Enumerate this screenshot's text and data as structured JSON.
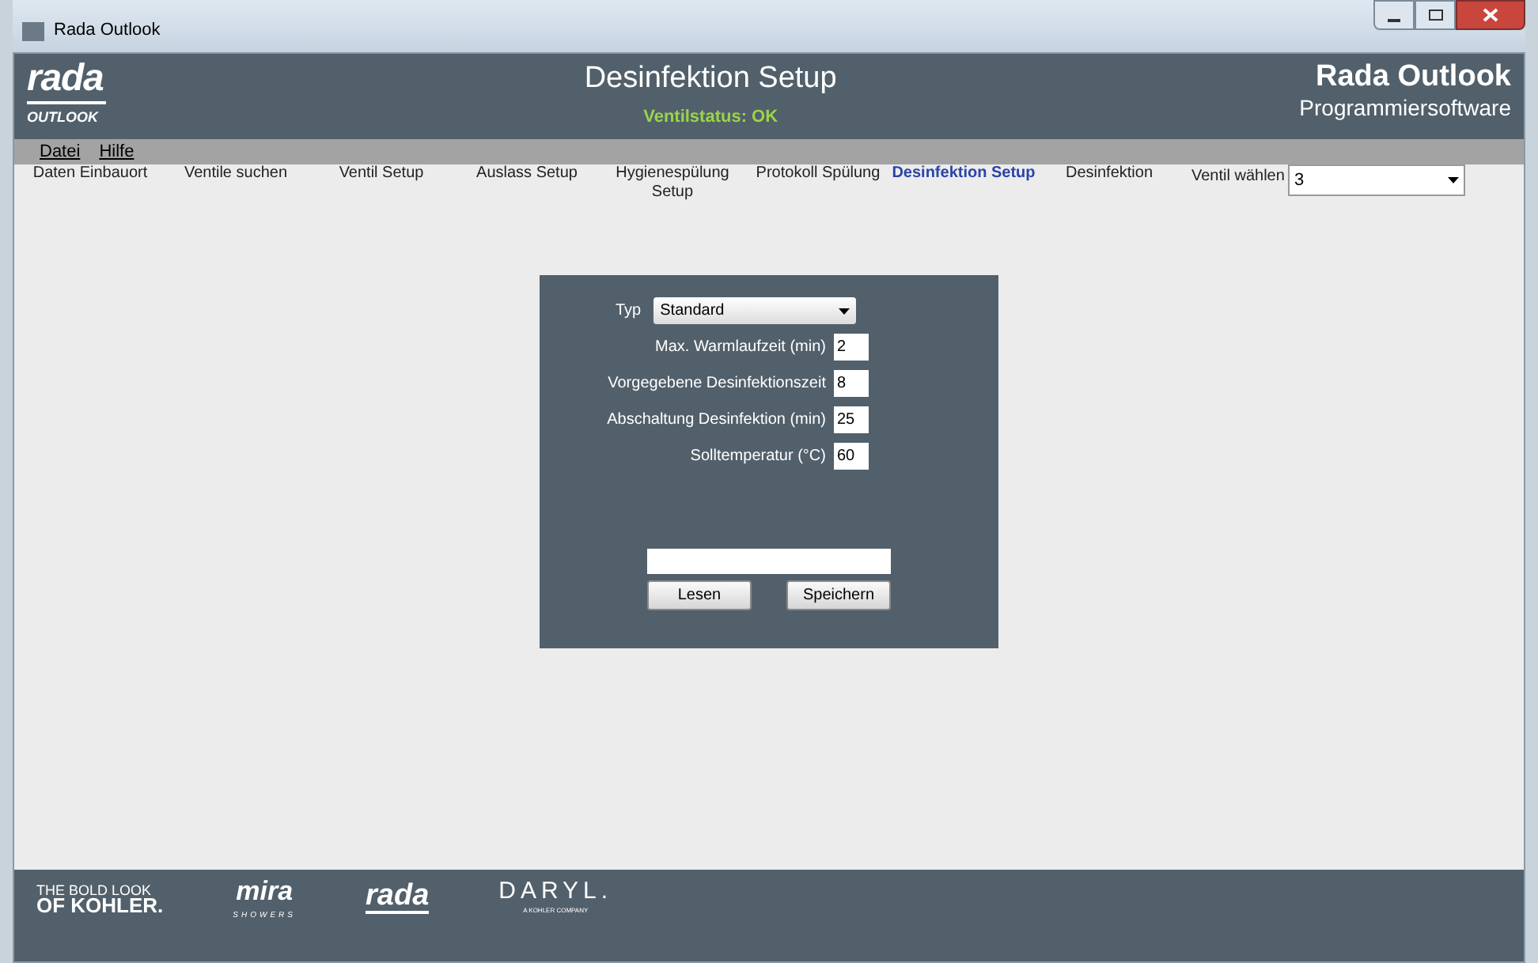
{
  "window": {
    "title": "Rada Outlook"
  },
  "header": {
    "logo_text": "rada",
    "logo_subtext": "OUTLOOK",
    "title": "Desinfektion Setup",
    "status": "Ventilstatus: OK",
    "brand": "Rada Outlook",
    "subtitle": "Programmiersoftware"
  },
  "menu": [
    "Datei",
    "Hilfe"
  ],
  "tabs": [
    {
      "label": "Daten Einbauort",
      "selected": false
    },
    {
      "label": "Ventile suchen",
      "selected": false
    },
    {
      "label": "Ventil Setup",
      "selected": false
    },
    {
      "label": "Auslass Setup",
      "selected": false
    },
    {
      "label": "Hygienespülung Setup",
      "selected": false
    },
    {
      "label": "Protokoll Spülung",
      "selected": false
    },
    {
      "label": "Desinfektion Setup",
      "selected": true
    },
    {
      "label": "Desinfektion",
      "selected": false
    }
  ],
  "valve_select": {
    "label": "Ventil wählen",
    "value": "3"
  },
  "form": {
    "type_label": "Typ",
    "type_value": "Standard",
    "fields": [
      {
        "label": "Max. Warmlaufzeit (min)",
        "value": "2"
      },
      {
        "label": "Vorgegebene Desinfektionszeit",
        "value": "8"
      },
      {
        "label": "Abschaltung Desinfektion (min)",
        "value": "25"
      },
      {
        "label": "Solltemperatur (°C)",
        "value": "60"
      }
    ],
    "buttons": [
      "Lesen",
      "Speichern"
    ]
  },
  "footer": {
    "kohler_top": "THE BOLD LOOK",
    "kohler_bottom": "OF KOHLER.",
    "mira": "mira",
    "mira_sub": "SHOWERS",
    "rada": "rada",
    "daryl": "DARYL.",
    "daryl_sub": "A KOHLER COMPANY"
  }
}
